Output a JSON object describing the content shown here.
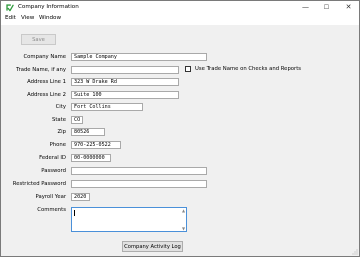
{
  "window": {
    "title": "Company Information",
    "minimize_glyph": "—",
    "maximize_glyph": "☐",
    "close_glyph": "✕"
  },
  "menu": [
    "Edit",
    "View",
    "Window"
  ],
  "toolbar": {
    "save_label": "Save",
    "save_enabled": false
  },
  "form": {
    "company_name": {
      "label": "Company Name",
      "value": "Sample Company"
    },
    "trade_name": {
      "label": "Trade Name, if any",
      "value": ""
    },
    "use_trade_name": {
      "label": "Use Trade Name on Checks and Reports",
      "checked": false
    },
    "address_line_1": {
      "label": "Address Line 1",
      "value": "323 W Drake Rd"
    },
    "address_line_2": {
      "label": "Address Line 2",
      "value": "Suite 100"
    },
    "city": {
      "label": "City",
      "value": "Fort Collins"
    },
    "state": {
      "label": "State",
      "value": "CO"
    },
    "zip": {
      "label": "Zip",
      "value": "80526"
    },
    "phone": {
      "label": "Phone",
      "value": "970-225-0522"
    },
    "federal_id": {
      "label": "Federal ID",
      "value": "00-0000000"
    },
    "password": {
      "label": "Password",
      "value": ""
    },
    "restricted_password": {
      "label": "Restricted Password",
      "value": ""
    },
    "payroll_year": {
      "label": "Payroll Year",
      "value": "2020"
    },
    "comments": {
      "label": "Comments",
      "value": ""
    }
  },
  "footer": {
    "activity_log_label": "Company Activity Log"
  },
  "colors": {
    "accent": "#2e9a3c",
    "focus_border": "#4a90d9"
  },
  "icons": {
    "app": "app-icon",
    "resize": "resize-grip-icon"
  }
}
